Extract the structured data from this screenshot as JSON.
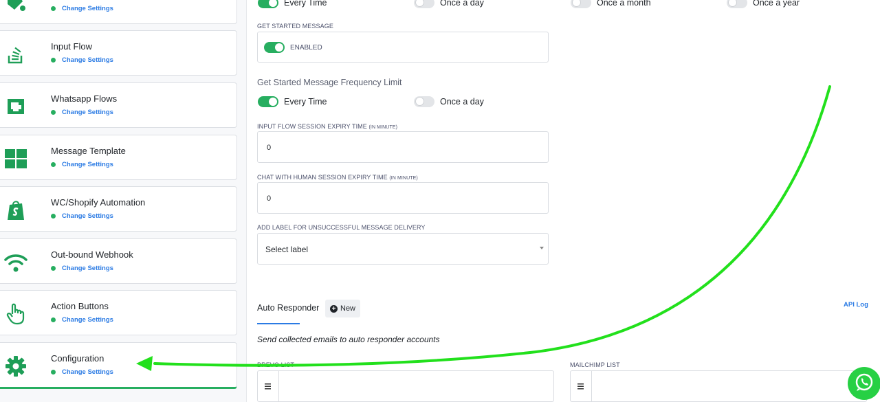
{
  "sidebar": {
    "items": [
      {
        "title": "",
        "sub": "Change Settings",
        "icon": "paint-bucket-icon"
      },
      {
        "title": "Input Flow",
        "sub": "Change Settings",
        "icon": "stack-overflow-icon"
      },
      {
        "title": "Whatsapp Flows",
        "sub": "Change Settings",
        "icon": "window-icon"
      },
      {
        "title": "Message Template",
        "sub": "Change Settings",
        "icon": "grid-icon"
      },
      {
        "title": "WC/Shopify Automation",
        "sub": "Change Settings",
        "icon": "shopify-bag-icon"
      },
      {
        "title": "Out-bound Webhook",
        "sub": "Change Settings",
        "icon": "wifi-icon"
      },
      {
        "title": "Action Buttons",
        "sub": "Change Settings",
        "icon": "pointer-hand-icon"
      },
      {
        "title": "Configuration",
        "sub": "Change Settings",
        "icon": "gear-icon"
      }
    ]
  },
  "main": {
    "top_toggles": [
      {
        "label": "Every Time",
        "on": true
      },
      {
        "label": "Once a day",
        "on": false
      },
      {
        "label": "Once a month",
        "on": false
      },
      {
        "label": "Once a year",
        "on": false
      }
    ],
    "get_started": {
      "label": "GET STARTED MESSAGE",
      "toggle_label": "ENABLED"
    },
    "freq_limit": {
      "title": "Get Started Message Frequency Limit",
      "options": [
        {
          "label": "Every Time",
          "on": true
        },
        {
          "label": "Once a day",
          "on": false
        }
      ]
    },
    "input_flow_expiry": {
      "label": "INPUT FLOW SESSION EXPIRY TIME",
      "unit": "(IN MINUTE)",
      "value": "0"
    },
    "chat_human_expiry": {
      "label": "CHAT WITH HUMAN SESSION EXPIRY TIME",
      "unit": "(IN MINUTE)",
      "value": "0"
    },
    "unsuccessful_label": {
      "label": "ADD LABEL FOR UNSUCCESSFUL MESSAGE DELIVERY",
      "placeholder": "Select label"
    },
    "auto_responder": {
      "tab": "Auto Responder",
      "new_button": "New",
      "api_log": "API Log",
      "note": "Send collected emails to auto responder accounts",
      "brevo_label": "BREVO LIST",
      "mailchimp_label": "MAILCHIMP LIST"
    }
  },
  "colors": {
    "accent_green": "#27ae60",
    "link_blue": "#2b7be4",
    "annotation_arrow": "#22e01c"
  }
}
